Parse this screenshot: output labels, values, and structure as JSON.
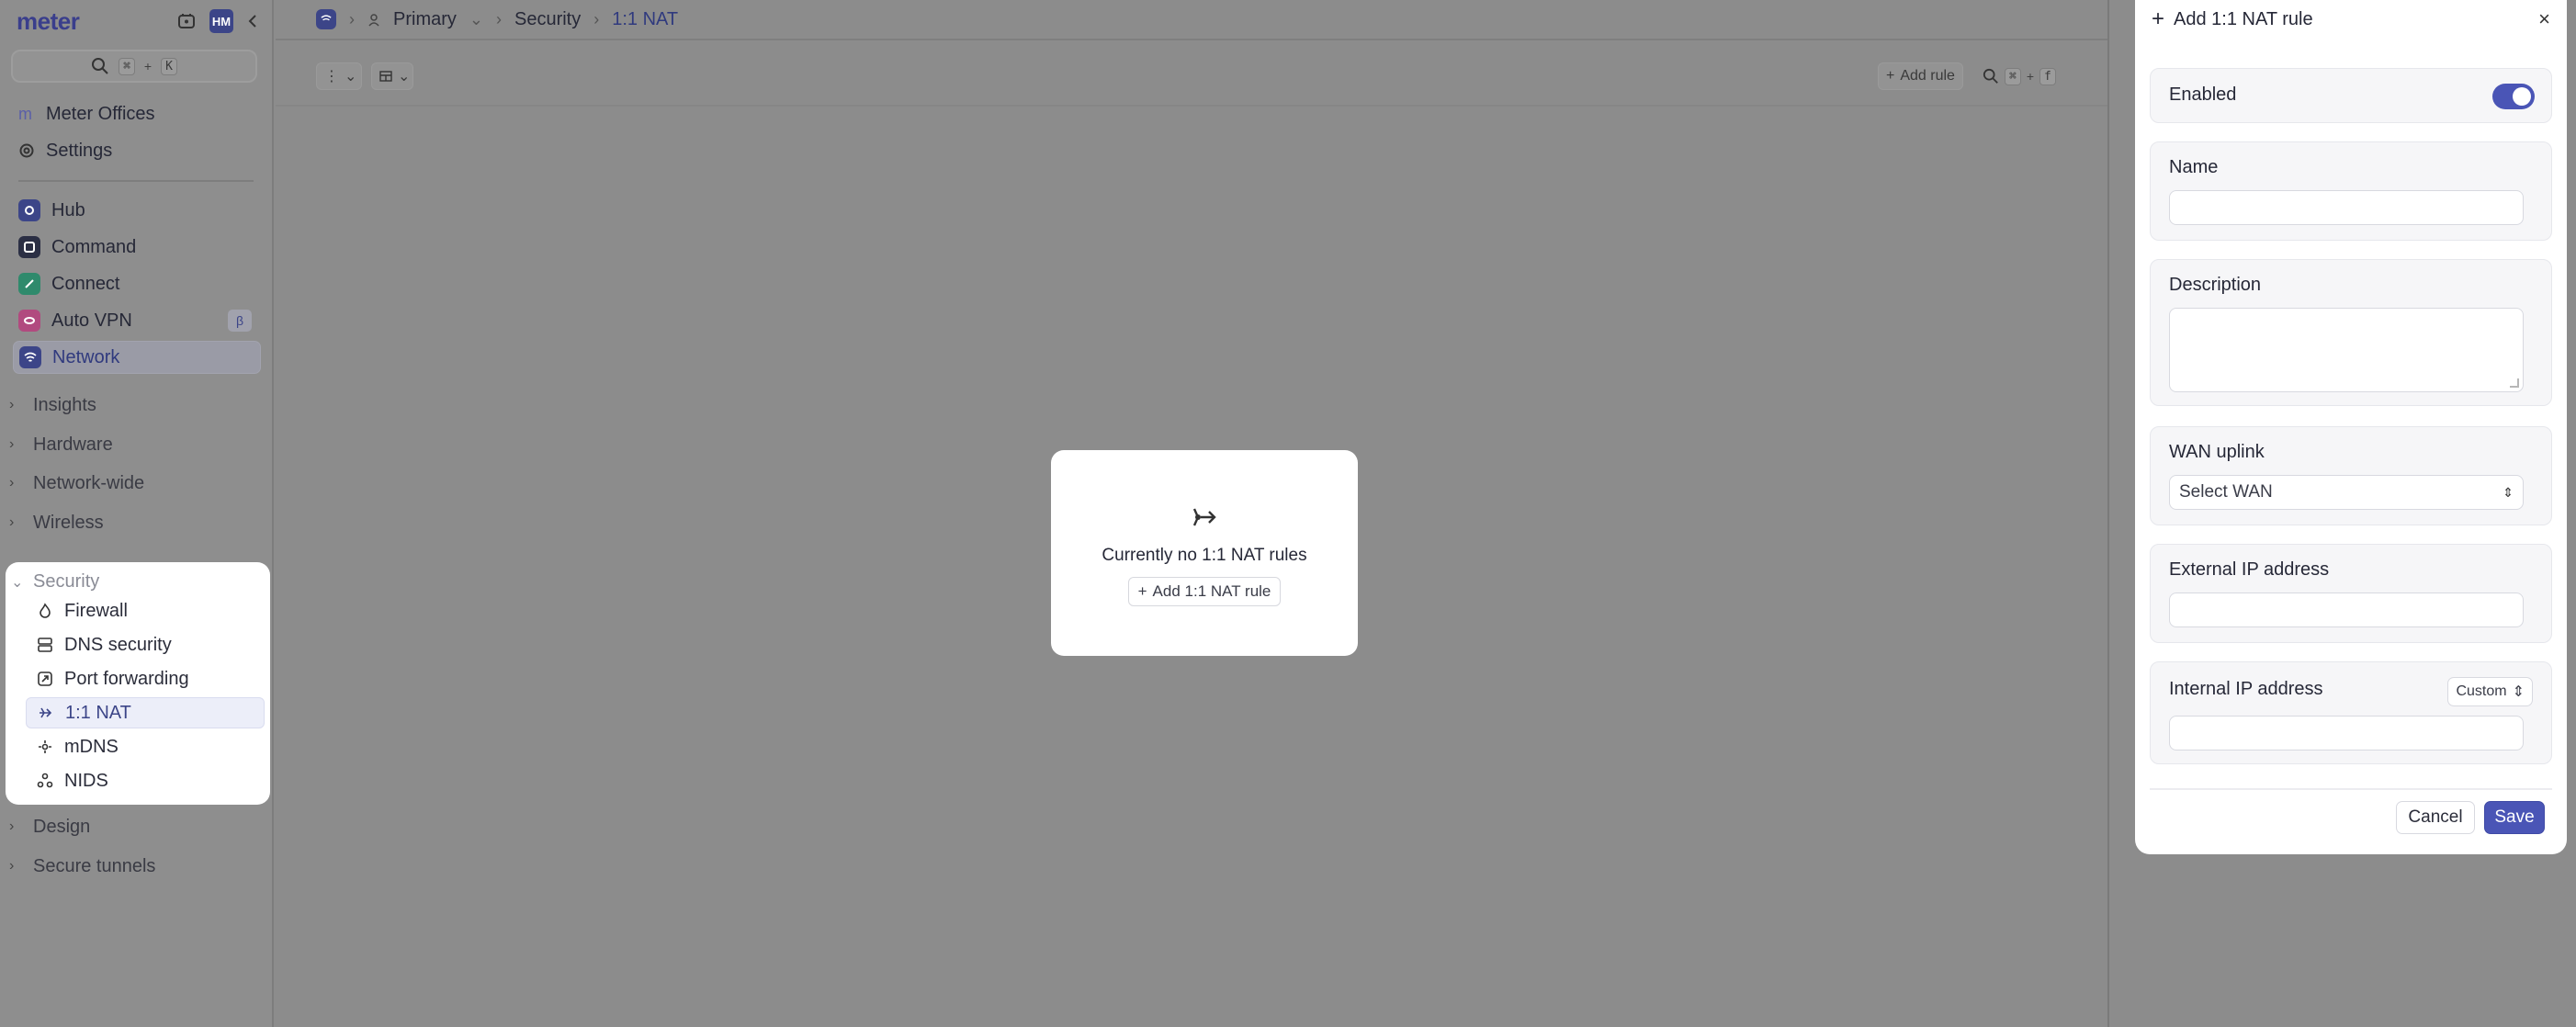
{
  "sidebar": {
    "logo": "meter",
    "avatar_initials": "HM",
    "search_keys": [
      "⌘",
      "+",
      "K"
    ],
    "locations": [
      {
        "label": "Meter Offices",
        "icon": "m-letter-icon"
      },
      {
        "label": "Settings",
        "icon": "gear-icon"
      }
    ],
    "apps": [
      {
        "label": "Hub",
        "color": "#3c4588"
      },
      {
        "label": "Command",
        "color": "#2b2f44"
      },
      {
        "label": "Connect",
        "color": "#2f8a6c"
      },
      {
        "label": "Auto VPN",
        "color": "#b14a7f",
        "badge": "β"
      },
      {
        "label": "Network",
        "color": "#3c4588",
        "active": true
      }
    ],
    "sections": [
      "Insights",
      "Hardware",
      "Network-wide",
      "Wireless"
    ],
    "security": {
      "label": "Security",
      "items": [
        "Firewall",
        "DNS security",
        "Port forwarding",
        "1:1 NAT",
        "mDNS",
        "NIDS"
      ],
      "active": "1:1 NAT"
    },
    "sections_after": [
      "Design",
      "Secure tunnels"
    ]
  },
  "breadcrumb": {
    "items": [
      "Primary",
      "Security",
      "1:1 NAT"
    ]
  },
  "toolbar": {
    "add_rule_label": "Add rule",
    "search_keys": [
      "⌘",
      "+",
      "f"
    ]
  },
  "empty_state": {
    "message": "Currently no 1:1 NAT rules",
    "button_label": "Add 1:1 NAT rule"
  },
  "drawer": {
    "title": "Add 1:1 NAT rule",
    "enabled_label": "Enabled",
    "enabled": true,
    "name_label": "Name",
    "name_value": "",
    "description_label": "Description",
    "description_value": "",
    "wan_label": "WAN uplink",
    "wan_selected": "Select WAN",
    "external_ip_label": "External IP address",
    "external_ip_value": "",
    "internal_ip_label": "Internal IP address",
    "internal_ip_mode": "Custom",
    "internal_ip_value": "",
    "cancel_label": "Cancel",
    "save_label": "Save"
  },
  "colors": {
    "accent": "#4a55b6",
    "overlay": "#8c8c8c"
  }
}
